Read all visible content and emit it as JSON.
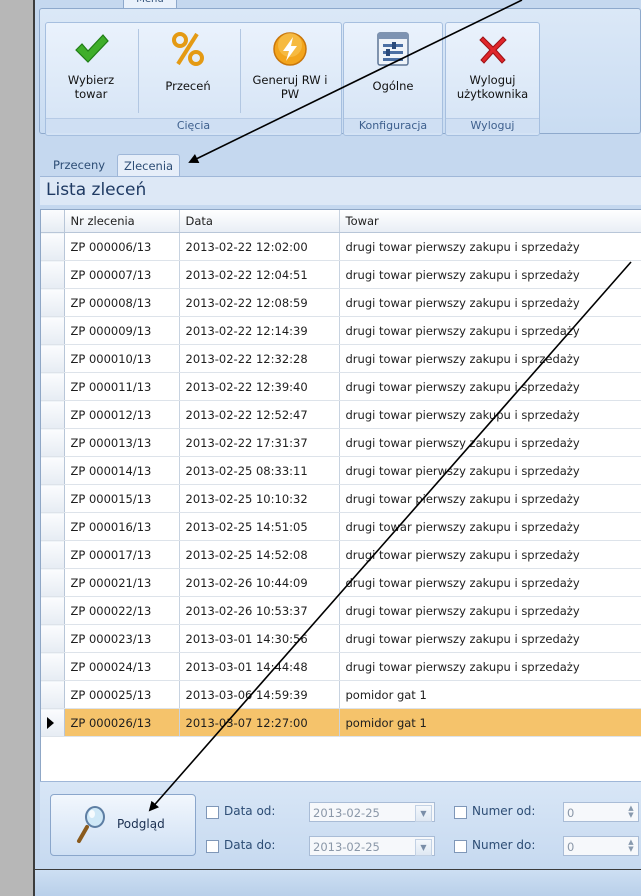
{
  "ribbon": {
    "tab_label": "Menu",
    "groups": {
      "ciecia": "Cięcia",
      "konfiguracja": "Konfiguracja",
      "wyloguj": "Wyloguj"
    },
    "buttons": {
      "wybierz_line1": "Wybierz",
      "wybierz_line2": "towar",
      "przecen": "Przeceń",
      "generuj_line1": "Generuj RW i",
      "generuj_line2": "PW",
      "ogolne": "Ogólne",
      "wyloguj_line1": "Wyloguj",
      "wyloguj_line2": "użytkownika"
    }
  },
  "tabs": [
    {
      "label": "Przeceny",
      "active": false
    },
    {
      "label": "Zlecenia",
      "active": true
    }
  ],
  "list_title": "Lista zleceń",
  "grid": {
    "columns": [
      "Nr zlecenia",
      "Data",
      "Towar"
    ],
    "rows": [
      [
        "ZP 000006/13",
        "2013-02-22 12:02:00",
        "drugi towar pierwszy zakupu i sprzedaży"
      ],
      [
        "ZP 000007/13",
        "2013-02-22 12:04:51",
        "drugi towar pierwszy zakupu i sprzedaży"
      ],
      [
        "ZP 000008/13",
        "2013-02-22 12:08:59",
        "drugi towar pierwszy zakupu i sprzedaży"
      ],
      [
        "ZP 000009/13",
        "2013-02-22 12:14:39",
        "drugi towar pierwszy zakupu i sprzedaży"
      ],
      [
        "ZP 000010/13",
        "2013-02-22 12:32:28",
        "drugi towar pierwszy zakupu i sprzedaży"
      ],
      [
        "ZP 000011/13",
        "2013-02-22 12:39:40",
        "drugi towar pierwszy zakupu i sprzedaży"
      ],
      [
        "ZP 000012/13",
        "2013-02-22 12:52:47",
        "drugi towar pierwszy zakupu i sprzedaży"
      ],
      [
        "ZP 000013/13",
        "2013-02-22 17:31:37",
        "drugi towar pierwszy zakupu i sprzedaży"
      ],
      [
        "ZP 000014/13",
        "2013-02-25 08:33:11",
        "drugi towar pierwszy zakupu i sprzedaży"
      ],
      [
        "ZP 000015/13",
        "2013-02-25 10:10:32",
        "drugi towar pierwszy zakupu i sprzedaży"
      ],
      [
        "ZP 000016/13",
        "2013-02-25 14:51:05",
        "drugi towar pierwszy zakupu i sprzedaży"
      ],
      [
        "ZP 000017/13",
        "2013-02-25 14:52:08",
        "drugi towar pierwszy zakupu i sprzedaży"
      ],
      [
        "ZP 000021/13",
        "2013-02-26 10:44:09",
        "drugi towar pierwszy zakupu i sprzedaży"
      ],
      [
        "ZP 000022/13",
        "2013-02-26 10:53:37",
        "drugi towar pierwszy zakupu i sprzedaży"
      ],
      [
        "ZP 000023/13",
        "2013-03-01 14:30:56",
        "drugi towar pierwszy zakupu i sprzedaży"
      ],
      [
        "ZP 000024/13",
        "2013-03-01 14:44:48",
        "drugi towar pierwszy zakupu i sprzedaży"
      ],
      [
        "ZP 000025/13",
        "2013-03-06 14:59:39",
        "pomidor gat 1"
      ],
      [
        "ZP 000026/13",
        "2013-03-07 12:27:00",
        "pomidor gat 1"
      ]
    ],
    "current_row": 17,
    "highlight_color": "#f5c36b"
  },
  "bottom": {
    "preview_button": "Podgląd",
    "data_od_label": "Data od:",
    "data_od_value": "2013-02-25",
    "data_do_label": "Data do:",
    "data_do_value": "2013-02-25",
    "numer_od_label": "Numer od:",
    "numer_od_value": "0",
    "numer_do_label": "Numer do:",
    "numer_do_value": "0"
  }
}
